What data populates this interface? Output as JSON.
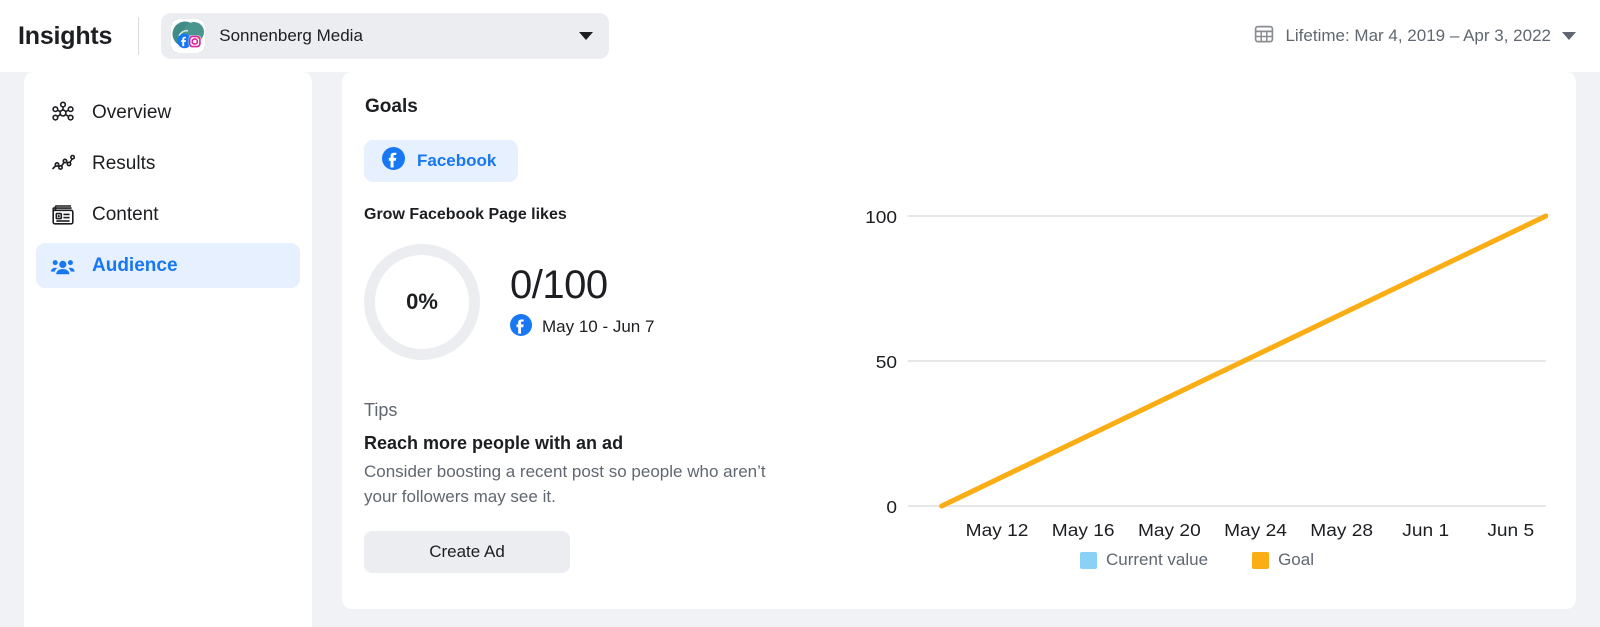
{
  "header": {
    "app_title": "Insights",
    "account": {
      "name": "Sonnenberg Media",
      "avatar_icon": "page-avatar",
      "facebook_badge_icon": "facebook-icon",
      "instagram_badge_icon": "instagram-icon",
      "caret_icon": "chevron-down-icon"
    },
    "date_range": {
      "calendar_icon": "calendar-icon",
      "label": "Lifetime: Mar 4, 2019 – Apr 3, 2022",
      "caret_icon": "chevron-down-icon"
    }
  },
  "sidebar": {
    "items": [
      {
        "label": "Overview",
        "icon": "overview-icon",
        "active": false
      },
      {
        "label": "Results",
        "icon": "results-icon",
        "active": false
      },
      {
        "label": "Content",
        "icon": "content-icon",
        "active": false
      },
      {
        "label": "Audience",
        "icon": "audience-icon",
        "active": true
      }
    ]
  },
  "main": {
    "title": "Goals",
    "tabs": [
      {
        "label": "Facebook",
        "icon": "facebook-icon",
        "selected": true
      }
    ],
    "goal": {
      "name": "Grow Facebook Page likes",
      "percent_label": "0%",
      "progress_percent": 0,
      "count_label": "0/100",
      "current_value": 0,
      "target_value": 100,
      "period_icon": "facebook-icon",
      "period_label": "May 10 - Jun 7"
    },
    "tips": {
      "heading": "Tips",
      "title": "Reach more people with an ad",
      "body": "Consider boosting a recent post so people who aren’t your followers may see it.",
      "cta_label": "Create Ad"
    }
  },
  "colors": {
    "accent_blue": "#1877f2",
    "goal_amber": "#faad14",
    "current_value_blue": "#89d2f5",
    "ring_gray": "#ebedf0",
    "page_bg": "#f0f2f5"
  },
  "chart_data": {
    "type": "line",
    "title": "",
    "xlabel": "",
    "ylabel": "",
    "ylim": [
      0,
      100
    ],
    "yticks": [
      0,
      50,
      100
    ],
    "ytick_labels": [
      "0",
      "50",
      "100"
    ],
    "xtick_labels": [
      "May 12",
      "May 16",
      "May 20",
      "May 24",
      "May 28",
      "Jun 1",
      "Jun 5"
    ],
    "grid": true,
    "legend_position": "bottom",
    "series": [
      {
        "name": "Current value",
        "color": "#89d2f5",
        "x": [
          "May 10"
        ],
        "values": [
          0
        ]
      },
      {
        "name": "Goal",
        "color": "#faad14",
        "x": [
          "May 10",
          "Jun 7"
        ],
        "values": [
          0,
          100
        ]
      }
    ]
  }
}
